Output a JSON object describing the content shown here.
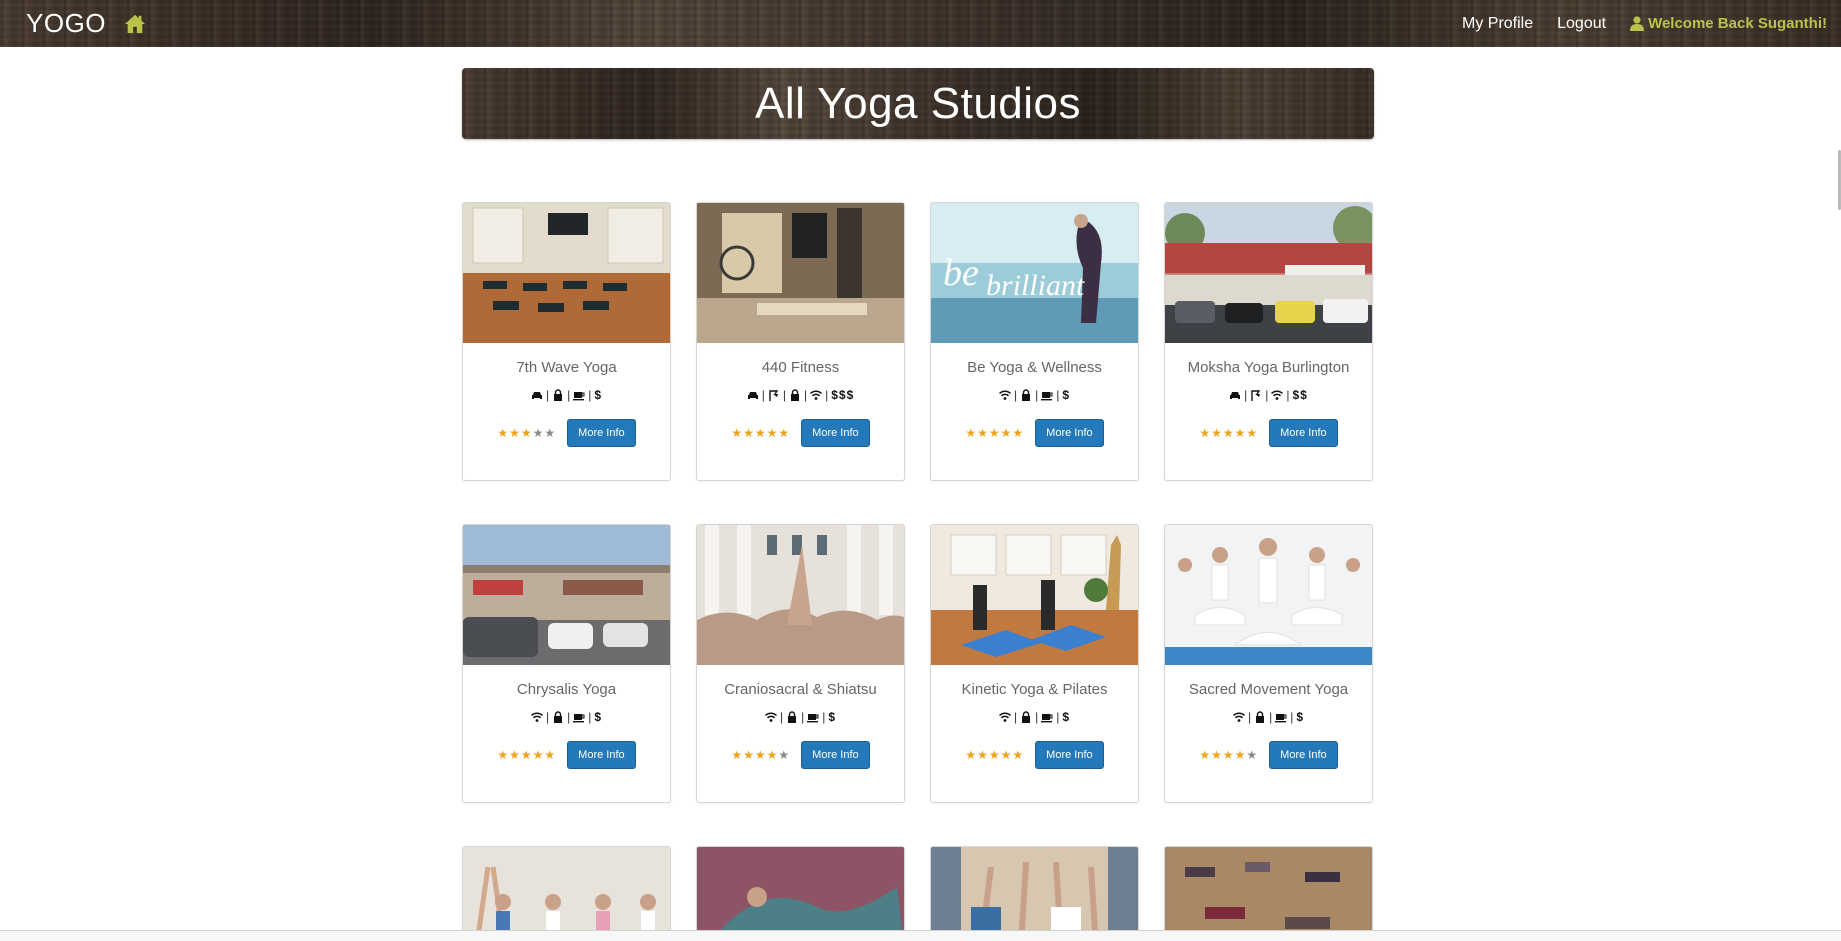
{
  "nav": {
    "brand": "YOGO",
    "links": {
      "profile": "My Profile",
      "logout": "Logout",
      "welcome": "Welcome Back Suganthi!"
    }
  },
  "banner": {
    "title": "All Yoga Studios"
  },
  "colors": {
    "accent": "#b9c24a",
    "button": "#2379b9",
    "star_on": "#f0a21b",
    "star_off": "#8a8a8a"
  },
  "studios": [
    {
      "name": "7th Wave Yoga",
      "amenities": [
        "car-icon",
        "lock-icon",
        "coffee-icon"
      ],
      "price": "$",
      "rating": 3,
      "button": "More Info"
    },
    {
      "name": "440 Fitness",
      "amenities": [
        "car-icon",
        "shower-icon",
        "lock-icon",
        "wifi-icon"
      ],
      "price": "$$$",
      "rating": 5,
      "button": "More Info"
    },
    {
      "name": "Be Yoga & Wellness",
      "amenities": [
        "wifi-icon",
        "lock-icon",
        "coffee-icon"
      ],
      "price": "$",
      "rating": 5,
      "button": "More Info"
    },
    {
      "name": "Moksha Yoga Burlington",
      "amenities": [
        "car-icon",
        "shower-icon",
        "wifi-icon"
      ],
      "price": "$$",
      "rating": 5,
      "button": "More Info"
    },
    {
      "name": "Chrysalis Yoga",
      "amenities": [
        "wifi-icon",
        "lock-icon",
        "coffee-icon"
      ],
      "price": "$",
      "rating": 5,
      "button": "More Info"
    },
    {
      "name": "Craniosacral & Shiatsu",
      "amenities": [
        "wifi-icon",
        "lock-icon",
        "coffee-icon"
      ],
      "price": "$",
      "rating": 4,
      "button": "More Info"
    },
    {
      "name": "Kinetic Yoga & Pilates",
      "amenities": [
        "wifi-icon",
        "lock-icon",
        "coffee-icon"
      ],
      "price": "$",
      "rating": 5,
      "button": "More Info"
    },
    {
      "name": "Sacred Movement Yoga",
      "amenities": [
        "wifi-icon",
        "lock-icon",
        "coffee-icon"
      ],
      "price": "$",
      "rating": 4,
      "button": "More Info"
    }
  ]
}
